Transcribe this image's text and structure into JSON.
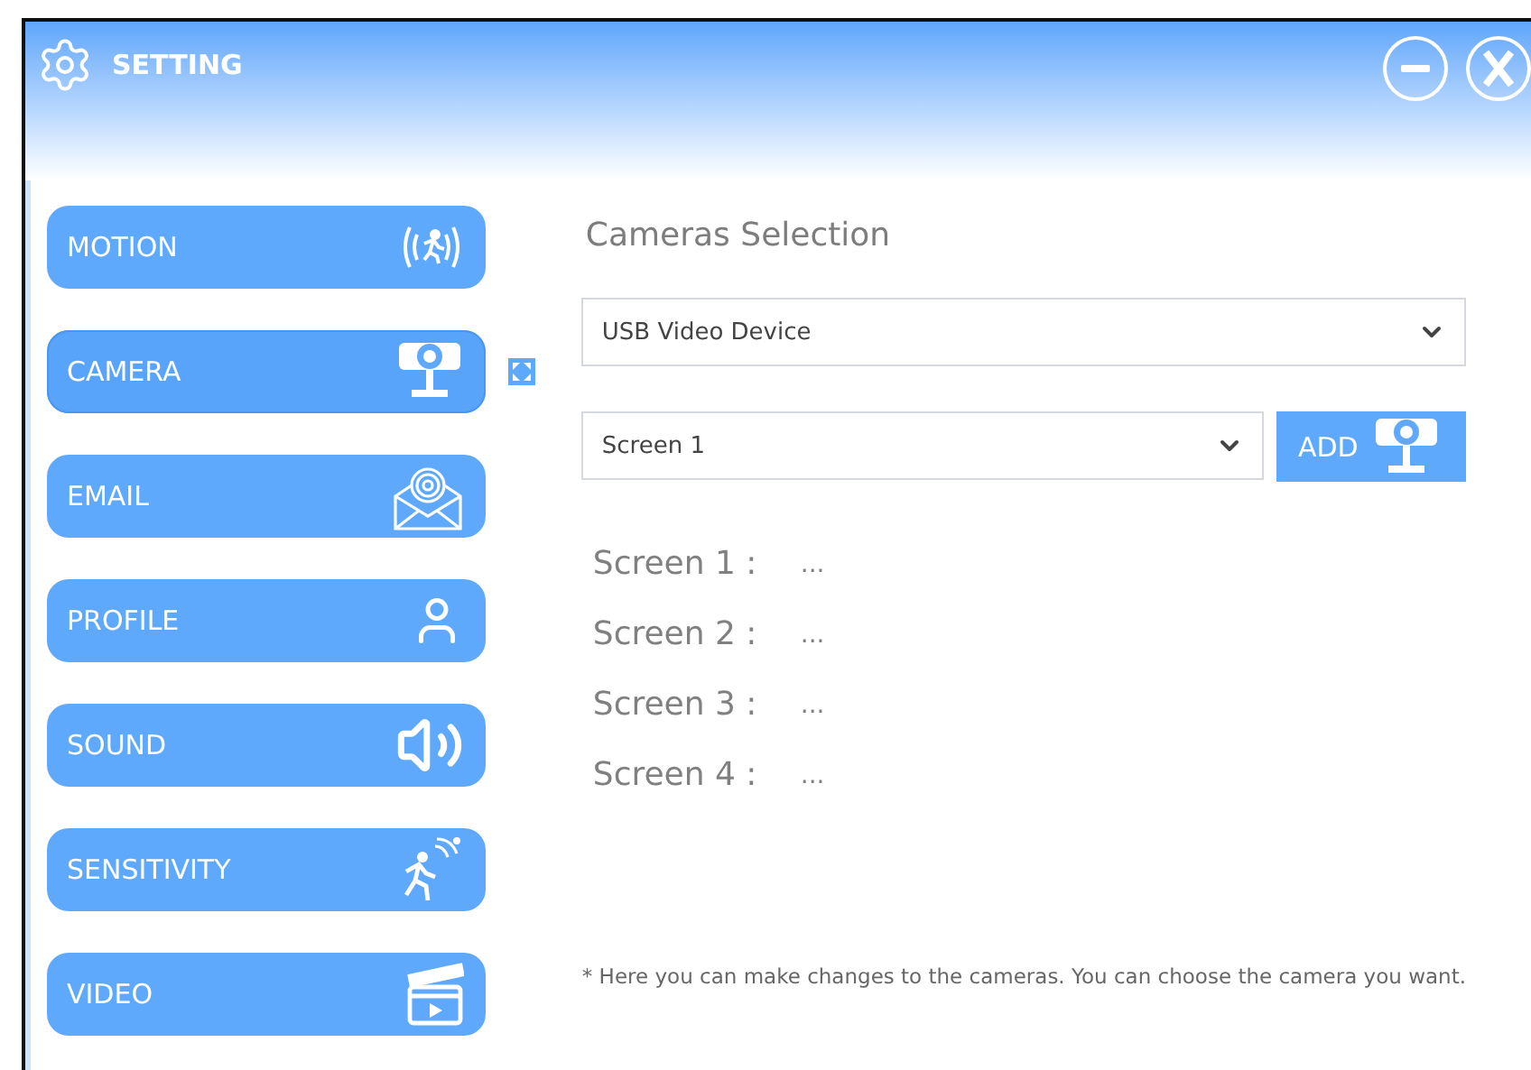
{
  "window": {
    "title": "SETTING"
  },
  "sidebar": {
    "items": [
      {
        "label": "MOTION",
        "kind": "motion",
        "selected": false
      },
      {
        "label": "CAMERA",
        "kind": "camera",
        "selected": true
      },
      {
        "label": "EMAIL",
        "kind": "email",
        "selected": false
      },
      {
        "label": "PROFILE",
        "kind": "profile",
        "selected": false
      },
      {
        "label": "SOUND",
        "kind": "sound",
        "selected": false
      },
      {
        "label": "SENSITIVITY",
        "kind": "sensitivity",
        "selected": false
      },
      {
        "label": "VIDEO",
        "kind": "video",
        "selected": false
      }
    ]
  },
  "content": {
    "title": "Cameras Selection",
    "device_select": {
      "value": "USB Video Device"
    },
    "screen_select": {
      "value": "Screen 1"
    },
    "add_button": {
      "label": "ADD"
    },
    "screens": [
      {
        "label": "Screen 1 :",
        "value": "..."
      },
      {
        "label": "Screen 2 :",
        "value": "..."
      },
      {
        "label": "Screen 3 :",
        "value": "..."
      },
      {
        "label": "Screen 4 :",
        "value": "..."
      }
    ],
    "note": "* Here you can make changes to the cameras. You can choose the camera you want."
  }
}
